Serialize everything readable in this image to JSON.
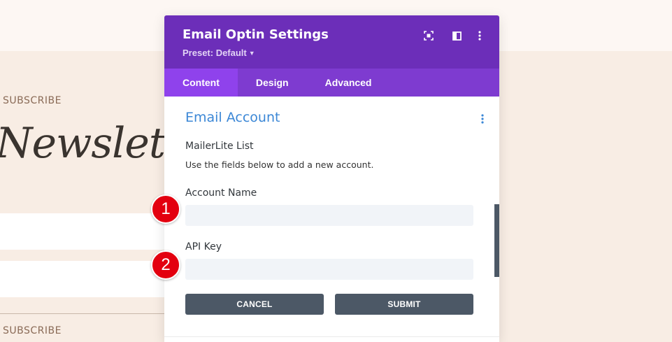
{
  "background_page": {
    "subscribe_top": "SUBSCRIBE",
    "title_fragment": "Newslett",
    "subscribe_bottom": "SUBSCRIBE"
  },
  "modal": {
    "title": "Email Optin Settings",
    "preset": "Preset: Default",
    "header_icons": [
      "focus-icon",
      "split-view-icon",
      "more-options-icon"
    ],
    "tabs": [
      {
        "label": "Content",
        "active": true
      },
      {
        "label": "Design",
        "active": false
      },
      {
        "label": "Advanced",
        "active": false
      }
    ]
  },
  "email_account": {
    "section_title": "Email Account",
    "list_label": "MailerLite List",
    "helper_text": "Use the fields below to add a new account.",
    "account_name": {
      "label": "Account Name",
      "value": "",
      "placeholder": ""
    },
    "api_key": {
      "label": "API Key",
      "value": "",
      "placeholder": ""
    },
    "cancel_label": "CANCEL",
    "submit_label": "SUBMIT"
  },
  "markers": [
    "1",
    "2"
  ],
  "colors": {
    "header": "#6c2eb9",
    "tabs": "#7e3bd0",
    "active_tab": "#8f42ec",
    "section_title": "#3b87d6",
    "button": "#4c5866",
    "field": "#f1f4f8",
    "marker": "#e3000f"
  }
}
